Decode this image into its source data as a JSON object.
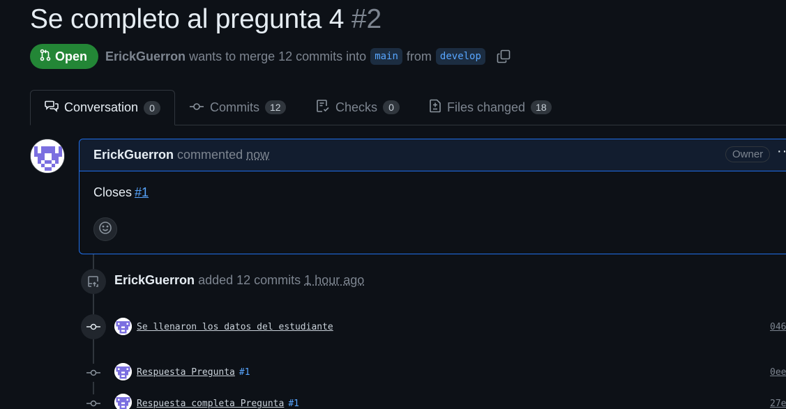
{
  "pr": {
    "title": "Se completo al pregunta 4",
    "number": "#2",
    "state": "Open",
    "author": "ErickGuerron",
    "merge_text_1": "wants to merge 12 commits into",
    "base_branch": "main",
    "merge_text_2": "from",
    "head_branch": "develop"
  },
  "tabs": [
    {
      "label": "Conversation",
      "count": "0",
      "icon": "conversation-icon"
    },
    {
      "label": "Commits",
      "count": "12",
      "icon": "commit-icon"
    },
    {
      "label": "Checks",
      "count": "0",
      "icon": "checklist-icon"
    },
    {
      "label": "Files changed",
      "count": "18",
      "icon": "file-diff-icon"
    }
  ],
  "comment": {
    "author": "ErickGuerron",
    "action": "commented",
    "time": "now",
    "badge": "Owner",
    "menu": "···",
    "body_text": "Closes",
    "body_ref": "#1"
  },
  "event": {
    "author": "ErickGuerron",
    "action": "added 12 commits",
    "time": "1 hour ago"
  },
  "commits": [
    {
      "message": "Se llenaron los datos del estudiante",
      "ref": "",
      "sha": "046"
    },
    {
      "message": "Respuesta Pregunta",
      "ref": "#1",
      "sha": "0ee"
    },
    {
      "message": "Respuesta completa Pregunta",
      "ref": "#1",
      "sha": "27e"
    }
  ],
  "colors": {
    "background": "#0d1117",
    "open_green": "#238636",
    "accent_blue": "#58a6ff",
    "comment_border": "#1f6feb"
  }
}
